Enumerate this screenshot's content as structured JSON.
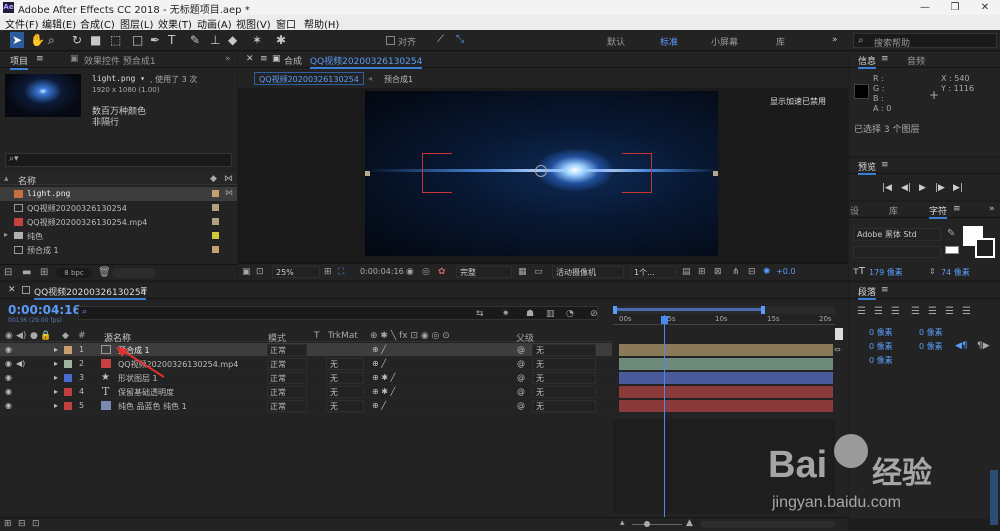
{
  "app": {
    "title": "Adobe After Effects CC 2018 - 无标题项目.aep *",
    "logo": "Ae"
  },
  "window_controls": [
    "—",
    "❐",
    "✕"
  ],
  "menu": [
    "文件(F)",
    "编辑(E)",
    "合成(C)",
    "图层(L)",
    "效果(T)",
    "动画(A)",
    "视图(V)",
    "窗口",
    "帮助(H)"
  ],
  "toolbar": {
    "align_label": "对齐",
    "workspaces": [
      "默认",
      "标准",
      "小屏幕",
      "库"
    ],
    "search_placeholder": "搜索帮助"
  },
  "project": {
    "tab": "项目",
    "effects_tab": "效果控件 预合成1",
    "item_name": "light.png ▾",
    "used": ", 使用了 3 次",
    "dims": "1920 x 1080 (1.00)",
    "colors": "数百万种颜色",
    "interlace": "非隔行",
    "column_name": "名称",
    "bpc": "8 bpc",
    "items": [
      {
        "name": "light.png",
        "color": "#c8a070"
      },
      {
        "name": "QQ视频20200326130254",
        "color": "#b4a07c"
      },
      {
        "name": "QQ视频20200326130254.mp4",
        "color": "#b4a07c"
      },
      {
        "name": "纯色",
        "color": "#d4c838"
      },
      {
        "name": "预合成 1",
        "color": "#c8a070"
      }
    ]
  },
  "composition": {
    "tab_prefix": "合成",
    "tab_name": "QQ视频20200326130254",
    "breadcrumb": "QQ视频20200326130254",
    "precomp": "预合成1",
    "accel_text": "显示加速已禁用",
    "zoom": "25%",
    "timecode": "0:00:04:16",
    "quality": "完整",
    "camera": "活动摄像机",
    "views": "1个...",
    "exposure": "+0.0"
  },
  "info": {
    "tab": "信息",
    "audio_tab": "音频",
    "r": "R :",
    "g": "G :",
    "b": "B :",
    "a": "A : 0",
    "x": "X : 540",
    "y": "Y : 1116",
    "selected": "已选择 3 个图层"
  },
  "preview": {
    "tab": "预览",
    "controls": [
      "|◀",
      "◀|",
      "▶",
      "|▶",
      "▶|"
    ]
  },
  "character": {
    "tabs": [
      "设",
      "库",
      "字符"
    ],
    "font": "Adobe 黑体 Std",
    "size": "179 像素",
    "leading": "74 像素",
    "tracking": "像素"
  },
  "paragraph": {
    "tab": "段落",
    "values": [
      "0 像素",
      "0 像素",
      "0 像素",
      "0 像素",
      "0 像素"
    ]
  },
  "timeline": {
    "comp_tab": "QQ视频20200326130254",
    "timecode": "0:00:04:16",
    "fps": "00136 (29.00 fps)",
    "cols": {
      "num": "#",
      "name": "源名称",
      "mode": "模式",
      "t": "T",
      "trkmat": "TrkMat",
      "parent": "父级"
    },
    "ruler": [
      "00s",
      "05s",
      "10s",
      "15s",
      "20s"
    ],
    "layers": [
      {
        "num": "1",
        "name": "预合成 1",
        "mode": "正常",
        "trk": "",
        "parent": "无",
        "color": "#c8a070",
        "bar": "#8a7a58",
        "icon": "comp"
      },
      {
        "num": "2",
        "name": "QQ视频20200326130254.mp4",
        "mode": "正常",
        "trk": "无",
        "parent": "无",
        "color": "#a0b4a0",
        "bar": "#6e8a7a",
        "icon": "video"
      },
      {
        "num": "3",
        "name": "形状图层 1",
        "mode": "正常",
        "trk": "无",
        "parent": "无",
        "color": "#4a6ad0",
        "bar": "#4a5a9a",
        "icon": "star"
      },
      {
        "num": "4",
        "name": "保留基础透明度",
        "mode": "正常",
        "trk": "无",
        "parent": "无",
        "color": "#c04040",
        "bar": "#8a3a3a",
        "icon": "text"
      },
      {
        "num": "5",
        "name": "纯色 品蓝色 纯色 1",
        "mode": "正常",
        "trk": "无",
        "parent": "无",
        "color": "#c04040",
        "bar": "#8a3a3a",
        "icon": "solid"
      }
    ]
  },
  "watermark": {
    "brand": "Bai",
    "brand2": "经验",
    "url": "jingyan.baidu.com"
  },
  "colors": {
    "accent": "#3a7fd5",
    "playhead": "#4a8af0"
  }
}
